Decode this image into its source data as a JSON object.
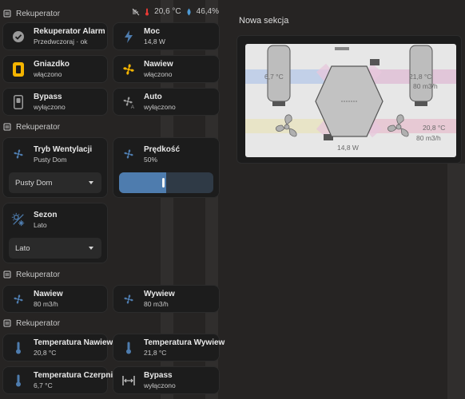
{
  "header": {
    "title": "Rekuperator",
    "status_temp": "20,6 °C",
    "status_humidity": "46,4%"
  },
  "section1": {
    "tiles": [
      {
        "name": "Rekuperator Alarm",
        "state": "Przedwczoraj · ok",
        "icon": "check-circle-icon"
      },
      {
        "name": "Moc",
        "state": "14,8 W",
        "icon": "flash-icon"
      },
      {
        "name": "Gniazdko",
        "state": "włączono",
        "icon": "power-socket-icon"
      },
      {
        "name": "Nawiew",
        "state": "włączono",
        "icon": "fan-icon"
      },
      {
        "name": "Bypass",
        "state": "wyłączono",
        "icon": "switch-icon"
      },
      {
        "name": "Auto",
        "state": "wyłączono",
        "icon": "fan-auto-icon"
      }
    ]
  },
  "section2": {
    "title": "Rekuperator",
    "mode": {
      "name": "Tryb Wentylacji",
      "state": "Pusty Dom",
      "select_value": "Pusty Dom"
    },
    "speed": {
      "name": "Prędkość",
      "state": "50%",
      "value_percent": 50
    },
    "season": {
      "name": "Sezon",
      "state": "Lato",
      "select_value": "Lato"
    }
  },
  "section3": {
    "title": "Rekuperator",
    "tiles": [
      {
        "name": "Nawiew",
        "state": "80 m3/h",
        "icon": "fan-icon"
      },
      {
        "name": "Wywiew",
        "state": "80 m3/h",
        "icon": "fan-icon"
      }
    ]
  },
  "section4": {
    "title": "Rekuperator",
    "tiles": [
      {
        "name": "Temperatura Nawiew",
        "state": "20,8 °C",
        "icon": "thermometer-icon"
      },
      {
        "name": "Temperatura Wywiew",
        "state": "21,8 °C",
        "icon": "thermometer-icon"
      },
      {
        "name": "Temperatura Czerpnia",
        "state": "6,7 °C",
        "icon": "thermometer-icon"
      },
      {
        "name": "Bypass",
        "state": "wyłączono",
        "icon": "arrow-split-icon"
      }
    ]
  },
  "right": {
    "title": "Nowa sekcja",
    "diagram": {
      "czerpnia_temp": "6,7 °C",
      "wywiew_temp": "21,8 °C",
      "wywiew_flow": "80 m3/h",
      "nawiew_temp": "20,8 °C",
      "nawiew_flow": "80 m3/h",
      "power": "14,8 W"
    }
  },
  "colors": {
    "accent_blue": "#4e7cae",
    "icon_yellow": "#f4b400",
    "card_bg": "#1c1c1c",
    "page_bg": "#262423"
  }
}
